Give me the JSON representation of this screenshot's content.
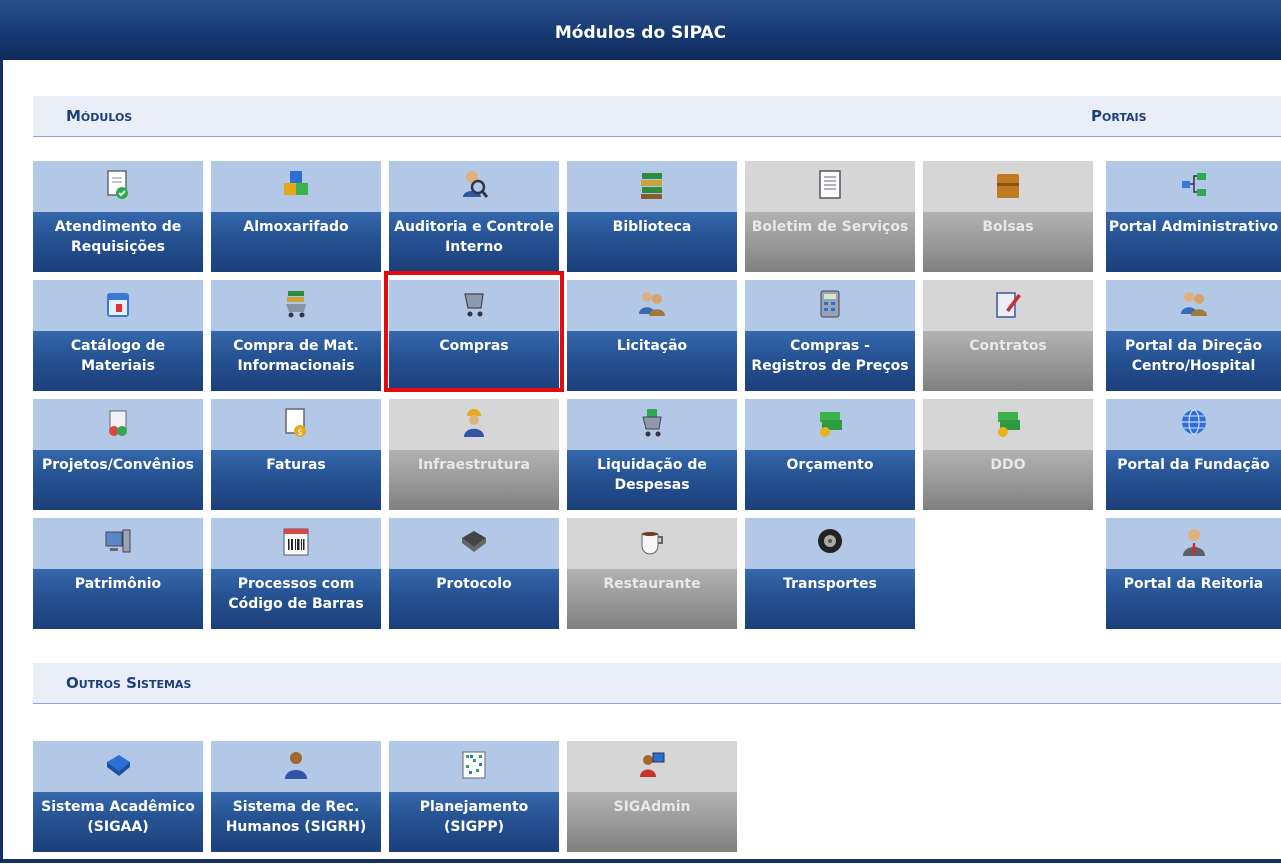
{
  "title": "Módulos do SIPAC",
  "sections": {
    "modulos": "Módulos",
    "portais": "Portais",
    "outros": "Outros Sistemas"
  },
  "modules": {
    "atendimento": {
      "l1": "Atendimento de",
      "l2": "Requisições"
    },
    "almoxarifado": {
      "l1": "Almoxarifado",
      "l2": ""
    },
    "auditoria": {
      "l1": "Auditoria e Controle",
      "l2": "Interno"
    },
    "biblioteca": {
      "l1": "Biblioteca",
      "l2": ""
    },
    "boletim": {
      "l1": "Boletim de Serviços",
      "l2": ""
    },
    "bolsas": {
      "l1": "Bolsas",
      "l2": ""
    },
    "catalogo": {
      "l1": "Catálogo de",
      "l2": "Materiais"
    },
    "compra_mat": {
      "l1": "Compra de Mat.",
      "l2": "Informacionais"
    },
    "compras": {
      "l1": "Compras",
      "l2": ""
    },
    "licitacao": {
      "l1": "Licitação",
      "l2": ""
    },
    "compras_rp": {
      "l1": "Compras -",
      "l2": "Registros de Preços"
    },
    "contratos": {
      "l1": "Contratos",
      "l2": ""
    },
    "projetos": {
      "l1": "Projetos/Convênios",
      "l2": ""
    },
    "faturas": {
      "l1": "Faturas",
      "l2": ""
    },
    "infraestrutura": {
      "l1": "Infraestrutura",
      "l2": ""
    },
    "liquidacao": {
      "l1": "Liquidação de",
      "l2": "Despesas"
    },
    "orcamento": {
      "l1": "Orçamento",
      "l2": ""
    },
    "ddo": {
      "l1": "DDO",
      "l2": ""
    },
    "patrimonio": {
      "l1": "Patrimônio",
      "l2": ""
    },
    "processos": {
      "l1": "Processos com",
      "l2": "Código de Barras"
    },
    "protocolo": {
      "l1": "Protocolo",
      "l2": ""
    },
    "restaurante": {
      "l1": "Restaurante",
      "l2": ""
    },
    "transportes": {
      "l1": "Transportes",
      "l2": ""
    }
  },
  "portals": {
    "administrativo": {
      "l1": "Portal Administrativo",
      "l2": ""
    },
    "direcao": {
      "l1": "Portal da Direção",
      "l2": "Centro/Hospital"
    },
    "fundacao": {
      "l1": "Portal da Fundação",
      "l2": ""
    },
    "reitoria": {
      "l1": "Portal da Reitoria",
      "l2": ""
    }
  },
  "others": {
    "sigaa": {
      "l1": "Sistema Acadêmico",
      "l2": "(SIGAA)"
    },
    "sigrh": {
      "l1": "Sistema de Rec.",
      "l2": "Humanos (SIGRH)"
    },
    "sigpp": {
      "l1": "Planejamento",
      "l2": "(SIGPP)"
    },
    "sigadmin": {
      "l1": "SIGAdmin",
      "l2": ""
    }
  },
  "icons": {
    "atendimento": "document-check-icon",
    "almoxarifado": "blocks-icon",
    "auditoria": "magnifier-person-icon",
    "biblioteca": "books-icon",
    "boletim": "document-lines-icon",
    "bolsas": "folder-icon",
    "catalogo": "calendar-icon",
    "compra_mat": "cart-books-icon",
    "compras": "shopping-cart-icon",
    "licitacao": "people-icon",
    "compras_rp": "calculator-icon",
    "contratos": "contract-pen-icon",
    "projetos": "scroll-icon",
    "faturas": "invoice-icon",
    "infraestrutura": "worker-icon",
    "liquidacao": "cart-icon",
    "orcamento": "money-icon",
    "ddo": "money-icon",
    "patrimonio": "computer-icon",
    "processos": "barcode-icon",
    "protocolo": "book-icon",
    "restaurante": "coffee-cup-icon",
    "transportes": "tire-icon",
    "administrativo": "network-icon",
    "direcao": "people-icon",
    "fundacao": "globe-icon",
    "reitoria": "person-tie-icon",
    "sigaa": "blue-book-icon",
    "sigrh": "person-icon",
    "sigpp": "grid-icon",
    "sigadmin": "admin-computer-icon"
  },
  "colors": {
    "header": "#173a73",
    "tile_active": "#275495",
    "tile_disabled": "#9a9a9a",
    "section_text": "#1e3f7a",
    "highlight": "#e30b0b"
  }
}
